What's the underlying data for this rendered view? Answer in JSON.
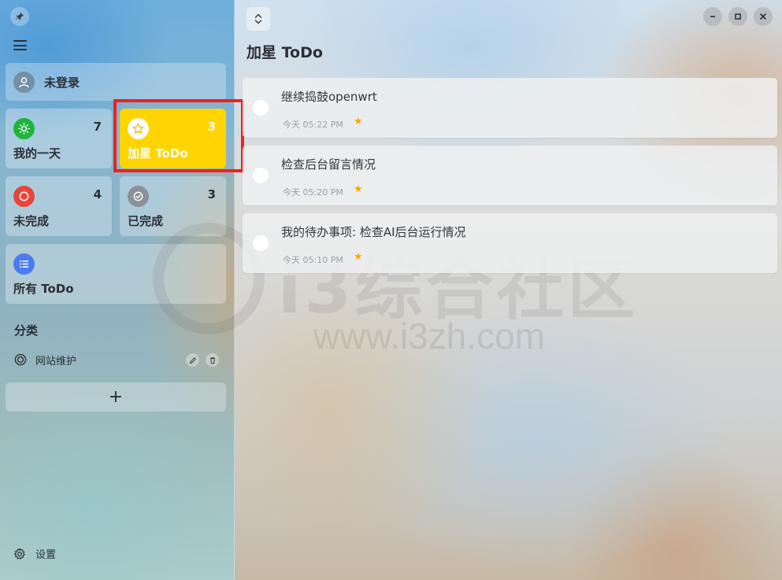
{
  "sidebar": {
    "user_label": "未登录",
    "cards": {
      "myday": {
        "label": "我的一天",
        "count": "7",
        "icon": "sun-icon",
        "icon_color": "#1eb53a"
      },
      "starred": {
        "label": "加星 ToDo",
        "count": "3",
        "icon": "star-icon",
        "icon_color": "#ffffff",
        "bg_color": "#ffd400"
      },
      "undone": {
        "label": "未完成",
        "count": "4",
        "icon": "circle-icon",
        "icon_color": "#e8453c"
      },
      "done": {
        "label": "已完成",
        "count": "3",
        "icon": "check-circle-icon",
        "icon_color": "#8a9298"
      },
      "all": {
        "label": "所有 ToDo",
        "icon": "list-icon",
        "icon_color": "#4a7cf0"
      }
    },
    "section_title": "分类",
    "categories": [
      {
        "label": "网站维护"
      }
    ],
    "add_label": "+",
    "settings_label": "设置"
  },
  "main": {
    "title": "加星 ToDo",
    "todos": [
      {
        "title": "继续捣鼓openwrt",
        "time": "今天 05:22 PM",
        "starred": true
      },
      {
        "title": "检查后台留言情况",
        "time": "今天 05:20 PM",
        "starred": true
      },
      {
        "title": "我的待办事项: 检查AI后台运行情况",
        "time": "今天 05:10 PM",
        "starred": true
      }
    ]
  },
  "watermark": {
    "text": "i3综合社区",
    "url": "www.i3zh.com"
  },
  "colors": {
    "highlight": "#f2201a",
    "star": "#f2a900"
  }
}
